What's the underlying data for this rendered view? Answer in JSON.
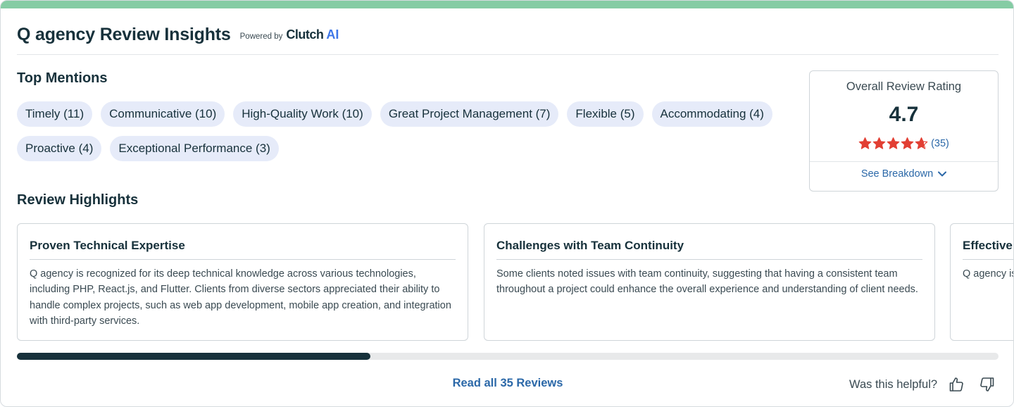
{
  "header": {
    "title": "Q agency Review Insights",
    "powered_by": "Powered by",
    "brand": "Clutch",
    "brand_ai": "AI"
  },
  "top_mentions": {
    "heading": "Top Mentions",
    "rows": [
      [
        "Timely (11)",
        "Communicative (10)",
        "High-Quality Work (10)",
        "Great Project Management (7)",
        "Flexible (5)",
        "Accommodating (4)"
      ],
      [
        "Proactive (4)",
        "Exceptional Performance (3)"
      ]
    ]
  },
  "rating": {
    "label": "Overall Review Rating",
    "value": "4.7",
    "stars_filled": 4.7,
    "stars_total": 5,
    "count": "(35)",
    "breakdown_label": "See Breakdown"
  },
  "highlights": {
    "heading": "Review Highlights",
    "cards": [
      {
        "title": "Proven Technical Expertise",
        "text": "Q agency is recognized for its deep technical knowledge across various technologies, including PHP, React.js, and Flutter. Clients from diverse sectors appreciated their ability to handle complex projects, such as web app development, mobile app creation, and integration with third-party services."
      },
      {
        "title": "Challenges with Team Continuity",
        "text": "Some clients noted issues with team continuity, suggesting that having a consistent team throughout a project could enhance the overall experience and understanding of client needs."
      },
      {
        "title": "Effective",
        "text": "Q agency is communica their struct"
      }
    ],
    "scroll_fraction": 0.36
  },
  "footer": {
    "read_all": "Read all 35 Reviews",
    "helpful_label": "Was this helpful?"
  },
  "colors": {
    "accent_strip": "#85cca4",
    "star": "#e23f33",
    "link": "#2b68a8",
    "chip_bg": "#e6ebf9",
    "text_dark": "#17313b",
    "ai_blue": "#3e76e8"
  },
  "icons": {
    "star": "star-icon",
    "chevron": "chevron-down-icon",
    "thumbs_up": "thumbs-up-icon",
    "thumbs_down": "thumbs-down-icon"
  }
}
